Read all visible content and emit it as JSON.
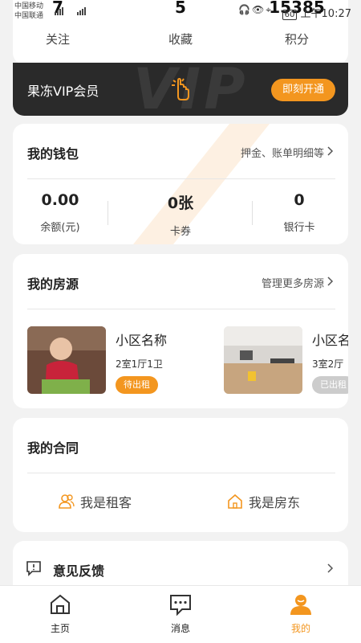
{
  "status_bar": {
    "carrier_1": "中国移动",
    "carrier_2": "中国联通",
    "network": "4G",
    "time": "上午10:27",
    "battery": "60"
  },
  "stats": [
    {
      "value": "7",
      "label": "关注"
    },
    {
      "value": "5",
      "label": "收藏"
    },
    {
      "value": "15385",
      "label": "积分"
    }
  ],
  "vip": {
    "title": "果冻VIP会员",
    "watermark": "VIP",
    "button": "即刻开通"
  },
  "wallet": {
    "title": "我的钱包",
    "link": "押金、账单明细等",
    "items": [
      {
        "value": "0.00",
        "label": "余额(元)"
      },
      {
        "value": "0张",
        "label": "卡券"
      },
      {
        "value": "0",
        "label": "银行卡"
      }
    ]
  },
  "properties": {
    "title": "我的房源",
    "link": "管理更多房源",
    "items": [
      {
        "name": "小区名称",
        "spec": "2室1厅1卫",
        "tag": "待出租"
      },
      {
        "name": "小区名称",
        "spec": "3室2厅",
        "tag": "已出租"
      }
    ]
  },
  "contract": {
    "title": "我的合同",
    "tenant": "我是租客",
    "landlord": "我是房东"
  },
  "feedback": {
    "title": "意见反馈"
  },
  "nav": {
    "home": "主页",
    "messages": "消息",
    "mine": "我的"
  },
  "colors": {
    "accent": "#f3961f",
    "vip_bg": "#2a2a2a",
    "tag_pending": "#f3961f",
    "tag_rented": "#cccccc"
  }
}
